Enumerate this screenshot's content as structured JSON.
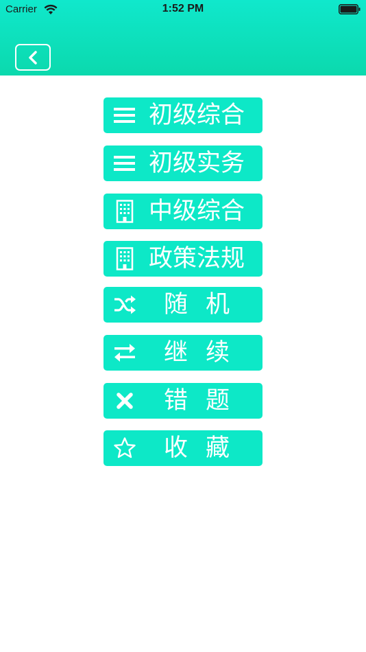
{
  "status_bar": {
    "carrier": "Carrier",
    "time": "1:52 PM"
  },
  "colors": {
    "header_top": "#10e8cc",
    "header_bottom": "#0bd9ad",
    "button_bg": "#0de8c7",
    "button_text": "#ffffff"
  },
  "nav": {
    "back_icon": "chevron-left-icon"
  },
  "menu": {
    "items": [
      {
        "label": "初级综合",
        "icon": "list-icon"
      },
      {
        "label": "初级实务",
        "icon": "list-icon"
      },
      {
        "label": "中级综合",
        "icon": "building-icon"
      },
      {
        "label": "政策法规",
        "icon": "building-icon"
      },
      {
        "label": "随机",
        "icon": "shuffle-icon"
      },
      {
        "label": "继续",
        "icon": "swap-arrows-icon"
      },
      {
        "label": "错题",
        "icon": "cross-icon"
      },
      {
        "label": "收藏",
        "icon": "star-icon"
      }
    ]
  }
}
